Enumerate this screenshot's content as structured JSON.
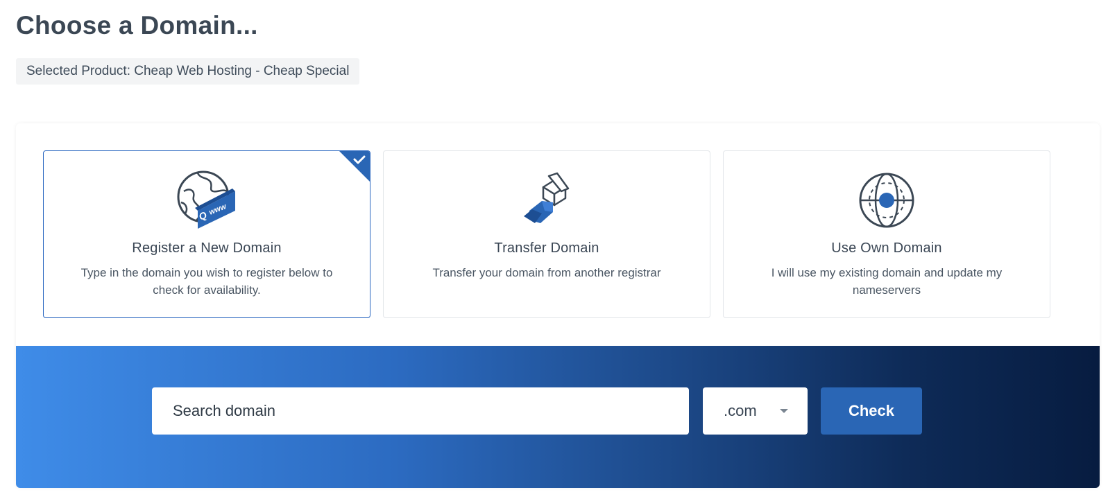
{
  "page_title": "Choose a Domain...",
  "selected_product": "Selected Product: Cheap Web Hosting - Cheap Special",
  "options": [
    {
      "title": "Register a New Domain",
      "description": "Type in the domain you wish to register below to check for availability.",
      "icon": "globe-www-icon",
      "selected": true
    },
    {
      "title": "Transfer Domain",
      "description": "Transfer your domain from another registrar",
      "icon": "transfer-box-icon",
      "selected": false
    },
    {
      "title": "Use Own Domain",
      "description": "I will use my existing domain and update my nameservers",
      "icon": "globe-target-icon",
      "selected": false
    }
  ],
  "search": {
    "placeholder": "Search domain",
    "value": ""
  },
  "tld": {
    "selected": ".com"
  },
  "check_label": "Check",
  "colors": {
    "accent": "#2a66b5",
    "selected_border": "#2a67c0",
    "gradient_start": "#3f8ce8",
    "gradient_end": "#071c40"
  }
}
